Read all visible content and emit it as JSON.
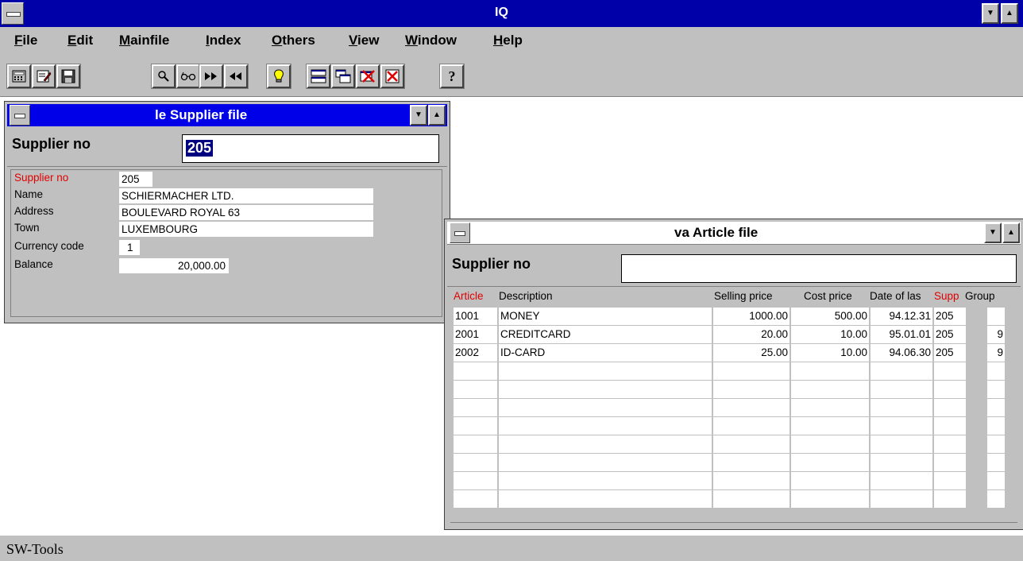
{
  "app": {
    "title": "IQ"
  },
  "menu": [
    {
      "label": "File",
      "u": "F",
      "rest": "ile"
    },
    {
      "label": "Edit",
      "u": "E",
      "rest": "dit"
    },
    {
      "label": "Mainfile",
      "u": "M",
      "rest": "ainfile"
    },
    {
      "label": "Index",
      "u": "I",
      "rest": "ndex"
    },
    {
      "label": "Others",
      "u": "O",
      "rest": "thers"
    },
    {
      "label": "View",
      "u": "V",
      "rest": "iew"
    },
    {
      "label": "Window",
      "u": "W",
      "rest": "indow"
    },
    {
      "label": "Help",
      "u": "H",
      "rest": "elp"
    }
  ],
  "toolbar": {
    "icons": [
      "calculator-icon",
      "print-preview-icon",
      "save-icon",
      "search-icon",
      "glasses-icon",
      "next-icon",
      "previous-icon",
      "lightbulb-icon",
      "window-tile-icon",
      "window-cascade-icon",
      "close-windows-icon",
      "close-icon",
      "help-icon"
    ]
  },
  "supplier_window": {
    "title": "le Supplier file",
    "key_label": "Supplier no",
    "key_value": "205",
    "fields": [
      {
        "label": "Supplier no",
        "value": "205",
        "key": true
      },
      {
        "label": "Name",
        "value": "SCHIERMACHER LTD."
      },
      {
        "label": "Address",
        "value": "BOULEVARD ROYAL 63"
      },
      {
        "label": "Town",
        "value": "LUXEMBOURG"
      },
      {
        "label": "Currency code",
        "value": "1"
      },
      {
        "label": "Balance",
        "value": "20,000.00"
      }
    ]
  },
  "article_window": {
    "title": "va Article file",
    "key_label": "Supplier no",
    "key_value": "",
    "columns": [
      "Article",
      "Description",
      "Selling price",
      "Cost price",
      "Date of las",
      "Supp",
      "Group"
    ],
    "rows": [
      [
        "1001",
        "MONEY",
        "1000.00",
        "500.00",
        "94.12.31",
        "205",
        ""
      ],
      [
        "2001",
        "CREDITCARD",
        "20.00",
        "10.00",
        "95.01.01",
        "205",
        "9"
      ],
      [
        "2002",
        "ID-CARD",
        "25.00",
        "10.00",
        "94.06.30",
        "205",
        "9"
      ]
    ]
  },
  "status": {
    "text": "SW-Tools"
  }
}
